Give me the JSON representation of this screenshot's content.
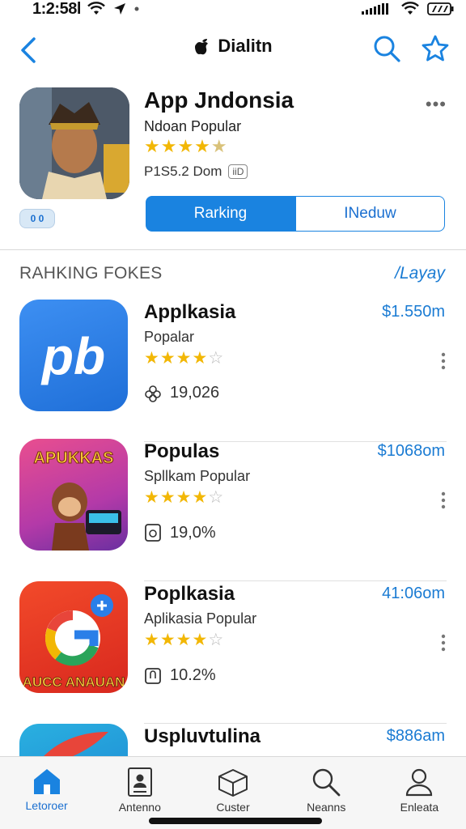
{
  "status": {
    "time": "1:2:58l"
  },
  "nav": {
    "title": "Dialitn"
  },
  "featured": {
    "name": "App Jndonsia",
    "subtitle": "Ndoan Popular",
    "stars": "★★★★",
    "price": "P1S5.2 Dom",
    "badge": "0 0",
    "age": "iiD",
    "seg_active": "Rarking",
    "seg_inactive": "INeduw"
  },
  "section": {
    "title": "RAHKING FOKES",
    "link": "Layay"
  },
  "apps": [
    {
      "name": "Applkasia",
      "subtitle": "Popalar",
      "price": "$1.550m",
      "meta": "19,026",
      "icon_text": "pb"
    },
    {
      "name": "Populas",
      "subtitle": "Spllkam Popular",
      "price": "$1068om",
      "meta": "19,0%",
      "icon_text": "APUKKAS"
    },
    {
      "name": "Poplkasia",
      "subtitle": "Aplikasia Popular",
      "price": "41:06om",
      "meta": "10.2%",
      "icon_text": "AUCC ANAUAN"
    },
    {
      "name": "Uspluvtulina",
      "subtitle": "",
      "price": "$886am",
      "meta": "",
      "icon_text": ""
    }
  ],
  "tabs": [
    {
      "label": "Letoroer",
      "icon": "home-icon"
    },
    {
      "label": "Antenno",
      "icon": "id-card-icon"
    },
    {
      "label": "Custer",
      "icon": "box-icon"
    },
    {
      "label": "Neanns",
      "icon": "search-icon"
    },
    {
      "label": "Enleata",
      "icon": "person-icon"
    }
  ],
  "colors": {
    "accent": "#1a83e0",
    "star": "#f2b705"
  }
}
